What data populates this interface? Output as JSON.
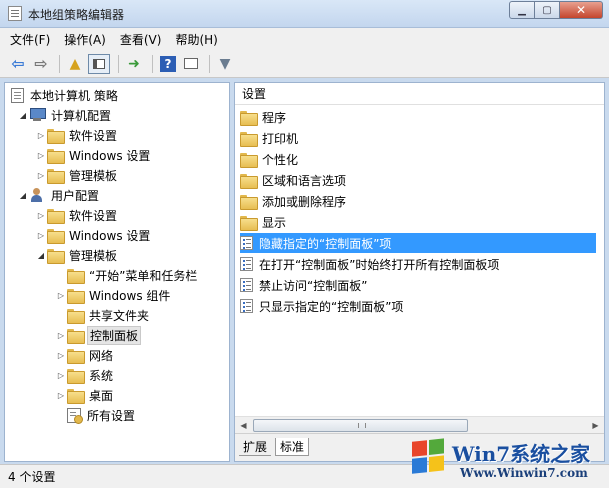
{
  "window": {
    "title": "本地组策略编辑器"
  },
  "menu": [
    "文件(F)",
    "操作(A)",
    "查看(V)",
    "帮助(H)"
  ],
  "tree": {
    "items": [
      {
        "label": "本地计算机 策略",
        "level": 0,
        "expander": "",
        "icon": "policy-doc"
      },
      {
        "label": "计算机配置",
        "level": 1,
        "expander": "open",
        "icon": "computer"
      },
      {
        "label": "软件设置",
        "level": 2,
        "expander": "closed",
        "icon": "folder"
      },
      {
        "label": "Windows 设置",
        "level": 2,
        "expander": "closed",
        "icon": "folder"
      },
      {
        "label": "管理模板",
        "level": 2,
        "expander": "closed",
        "icon": "folder"
      },
      {
        "label": "用户配置",
        "level": 1,
        "expander": "open",
        "icon": "user"
      },
      {
        "label": "软件设置",
        "level": 2,
        "expander": "closed",
        "icon": "folder"
      },
      {
        "label": "Windows 设置",
        "level": 2,
        "expander": "closed",
        "icon": "folder"
      },
      {
        "label": "管理模板",
        "level": 2,
        "expander": "open",
        "icon": "folder"
      },
      {
        "label": "“开始”菜单和任务栏",
        "level": 3,
        "expander": "",
        "icon": "folder"
      },
      {
        "label": "Windows 组件",
        "level": 3,
        "expander": "closed",
        "icon": "folder"
      },
      {
        "label": "共享文件夹",
        "level": 3,
        "expander": "",
        "icon": "folder"
      },
      {
        "label": "控制面板",
        "level": 3,
        "expander": "closed",
        "icon": "folder",
        "selected": true
      },
      {
        "label": "网络",
        "level": 3,
        "expander": "closed",
        "icon": "folder"
      },
      {
        "label": "系统",
        "level": 3,
        "expander": "closed",
        "icon": "folder"
      },
      {
        "label": "桌面",
        "level": 3,
        "expander": "closed",
        "icon": "folder"
      },
      {
        "label": "所有设置",
        "level": 3,
        "expander": "",
        "icon": "settings"
      }
    ]
  },
  "list": {
    "column_header": "设置",
    "items": [
      {
        "label": "程序",
        "icon": "folder"
      },
      {
        "label": "打印机",
        "icon": "folder"
      },
      {
        "label": "个性化",
        "icon": "folder"
      },
      {
        "label": "区域和语言选项",
        "icon": "folder"
      },
      {
        "label": "添加或删除程序",
        "icon": "folder"
      },
      {
        "label": "显示",
        "icon": "folder"
      },
      {
        "label": "隐藏指定的“控制面板”项",
        "icon": "policy",
        "selected": true
      },
      {
        "label": "在打开“控制面板”时始终打开所有控制面板项",
        "icon": "policy"
      },
      {
        "label": "禁止访问“控制面板”",
        "icon": "policy"
      },
      {
        "label": "只显示指定的“控制面板”项",
        "icon": "policy"
      }
    ]
  },
  "tabs": {
    "extended": "扩展",
    "standard": "标准"
  },
  "status": {
    "text": "4 个设置"
  },
  "watermark": {
    "brand": "Win7系统之家",
    "url": "Www.Winwin7.com"
  }
}
